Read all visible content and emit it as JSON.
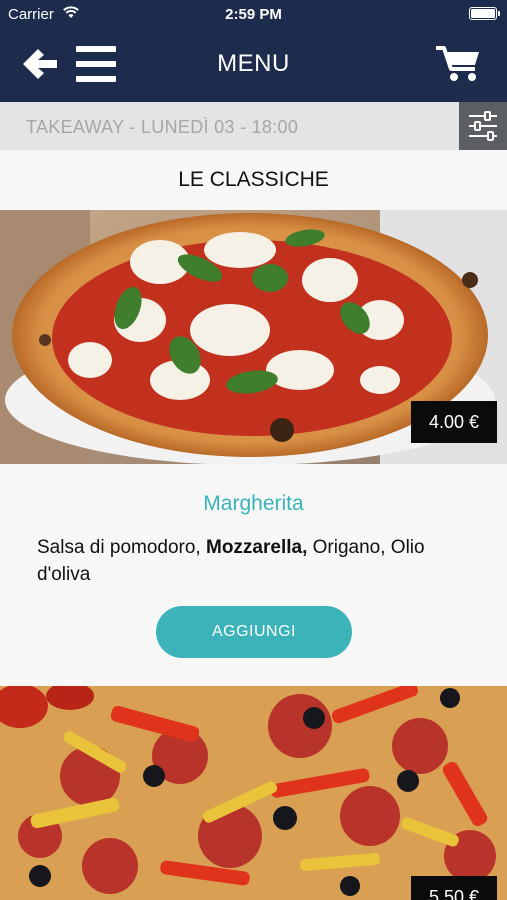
{
  "status_bar": {
    "carrier": "Carrier",
    "time": "2:59 PM"
  },
  "header": {
    "title": "MENU"
  },
  "filter": {
    "text": "TAKEAWAY - LUNEDÌ 03 - 18:00"
  },
  "section": {
    "title": "LE CLASSICHE"
  },
  "products": [
    {
      "name": "Margherita",
      "price": "4.00 €",
      "desc_1": "Salsa di pomodoro, ",
      "desc_bold": "Mozzarella,",
      "desc_2": " Origano, Olio d'oliva",
      "add_label": "AGGIUNGI"
    },
    {
      "price": "5.50 €"
    }
  ],
  "colors": {
    "header_bg": "#1d2b4c",
    "accent": "#3bb3b9",
    "filter_bg": "#e4e4e4",
    "filter_button_bg": "#5b5f63",
    "price_badge_bg": "#0b0b0b"
  }
}
